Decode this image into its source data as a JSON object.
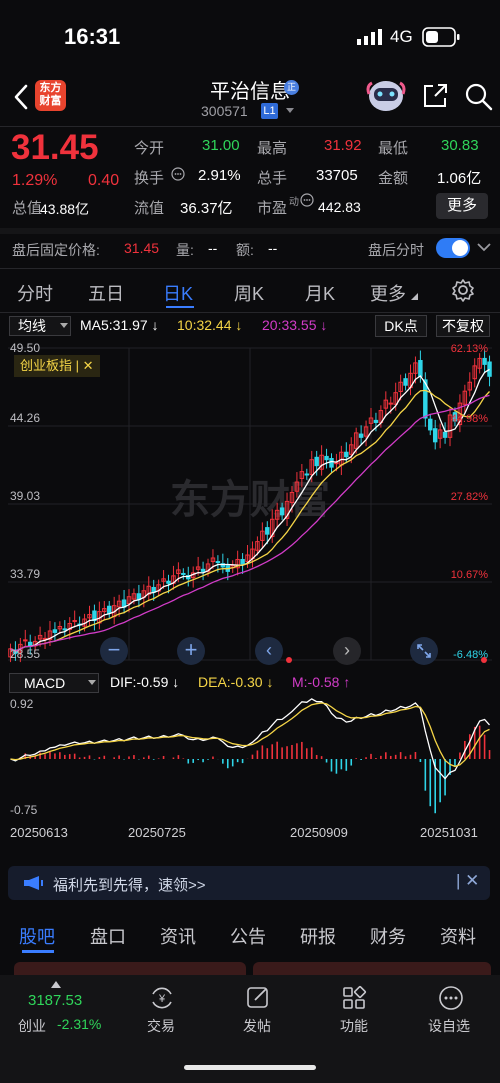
{
  "status": {
    "time": "16:31",
    "network": "4G"
  },
  "header": {
    "name": "平治信息",
    "code": "300571",
    "level": "L1",
    "logo_text": [
      "东方",
      "财富"
    ]
  },
  "quote": {
    "price": "31.45",
    "change_pct": "1.29%",
    "change": "0.40",
    "open_label": "今开",
    "open": "31.00",
    "high_label": "最高",
    "high": "31.92",
    "low_label": "最低",
    "low": "30.83",
    "turnover_label": "换手",
    "turnover": "2.91%",
    "volume_label": "总手",
    "volume": "33705",
    "amount_label": "金额",
    "amount": "1.06亿",
    "mktcap_label": "总值",
    "mktcap": "43.88亿",
    "float_label": "流值",
    "float": "36.37亿",
    "pe_label": "市盈",
    "pe_suffix": "动",
    "pe": "442.83",
    "more": "更多"
  },
  "after_hours": {
    "price_label": "盘后固定价格:",
    "price": "31.45",
    "vol_label": "量:",
    "vol": "--",
    "amt_label": "额:",
    "amt": "--",
    "toggle_label": "盘后分时"
  },
  "period_tabs": [
    "分时",
    "五日",
    "日K",
    "周K",
    "月K",
    "更多"
  ],
  "chart_controls": {
    "ma_selector": "均线",
    "ma5": "MA5:31.97",
    "ma10": "10:32.44",
    "ma20": "20:33.55",
    "dk": "DK点",
    "fq": "不复权",
    "index_tag": "创业板指",
    "watermark": "东方财富",
    "macd_selector": "MACD",
    "dif": "DIF:-0.59",
    "dea": "DEA:-0.30",
    "m": "M:-0.58"
  },
  "colors": {
    "up": "#f0323c",
    "down": "#2fd5e8",
    "accent": "#3a7dff",
    "ma5": "#ffffff",
    "ma10": "#f5d547",
    "ma20": "#d23cc8"
  },
  "chart_data": [
    {
      "type": "candlestick",
      "y_ticks_left": [
        "49.50",
        "44.26",
        "39.03",
        "33.79",
        "28.55"
      ],
      "y_ticks_right": [
        "62.13%",
        "44.98%",
        "27.82%",
        "10.67%",
        "-6.48%"
      ],
      "ylim": [
        28.55,
        49.5
      ],
      "x_labels": [
        "20250613",
        "20250725",
        "20250909",
        "20251031"
      ],
      "close": [
        29.3,
        29.0,
        29.6,
        29.9,
        29.5,
        29.8,
        30.2,
        30.0,
        30.5,
        30.4,
        30.8,
        30.6,
        31.0,
        31.2,
        30.9,
        31.3,
        31.6,
        31.2,
        31.8,
        32.0,
        31.7,
        32.2,
        32.5,
        32.1,
        32.8,
        33.0,
        32.6,
        33.2,
        33.5,
        33.1,
        33.6,
        34.0,
        33.7,
        34.2,
        34.6,
        34.3,
        34.0,
        34.4,
        34.8,
        34.5,
        35.0,
        35.4,
        35.1,
        34.8,
        34.5,
        34.9,
        35.3,
        35.0,
        35.6,
        36.0,
        36.5,
        37.2,
        37.0,
        38.0,
        38.6,
        38.3,
        39.2,
        39.8,
        40.5,
        41.2,
        41.0,
        42.0,
        41.6,
        42.3,
        42.0,
        41.5,
        41.8,
        42.5,
        42.2,
        43.0,
        43.8,
        43.5,
        44.2,
        44.8,
        44.5,
        45.3,
        46.0,
        45.8,
        46.5,
        47.2,
        47.0,
        47.8,
        48.5,
        47.6,
        44.8,
        44.0,
        43.2,
        44.0,
        43.5,
        45.0,
        44.6,
        45.8,
        46.6,
        47.2,
        48.3,
        48.8,
        48.4,
        47.6
      ],
      "ma5": 31.97,
      "ma10": 32.44,
      "ma20": 33.55
    },
    {
      "type": "bar",
      "name": "MACD",
      "y_ticks": [
        "0.92",
        "-0.75"
      ],
      "ylim": [
        -0.75,
        0.92
      ],
      "dif": -0.59,
      "dea": -0.3,
      "m": -0.58
    }
  ],
  "nav_buttons": [
    "minus",
    "plus",
    "prev",
    "next",
    "fullscreen"
  ],
  "promo": {
    "text": "福利先到先得，速领>>"
  },
  "bottom_tabs": [
    "股吧",
    "盘口",
    "资讯",
    "公告",
    "研报",
    "财务",
    "资料"
  ],
  "bottom_nav": {
    "index_value": "3187.53",
    "index_name": "创业",
    "index_change": "-2.31%",
    "items": [
      "交易",
      "发帖",
      "功能",
      "设自选"
    ]
  }
}
